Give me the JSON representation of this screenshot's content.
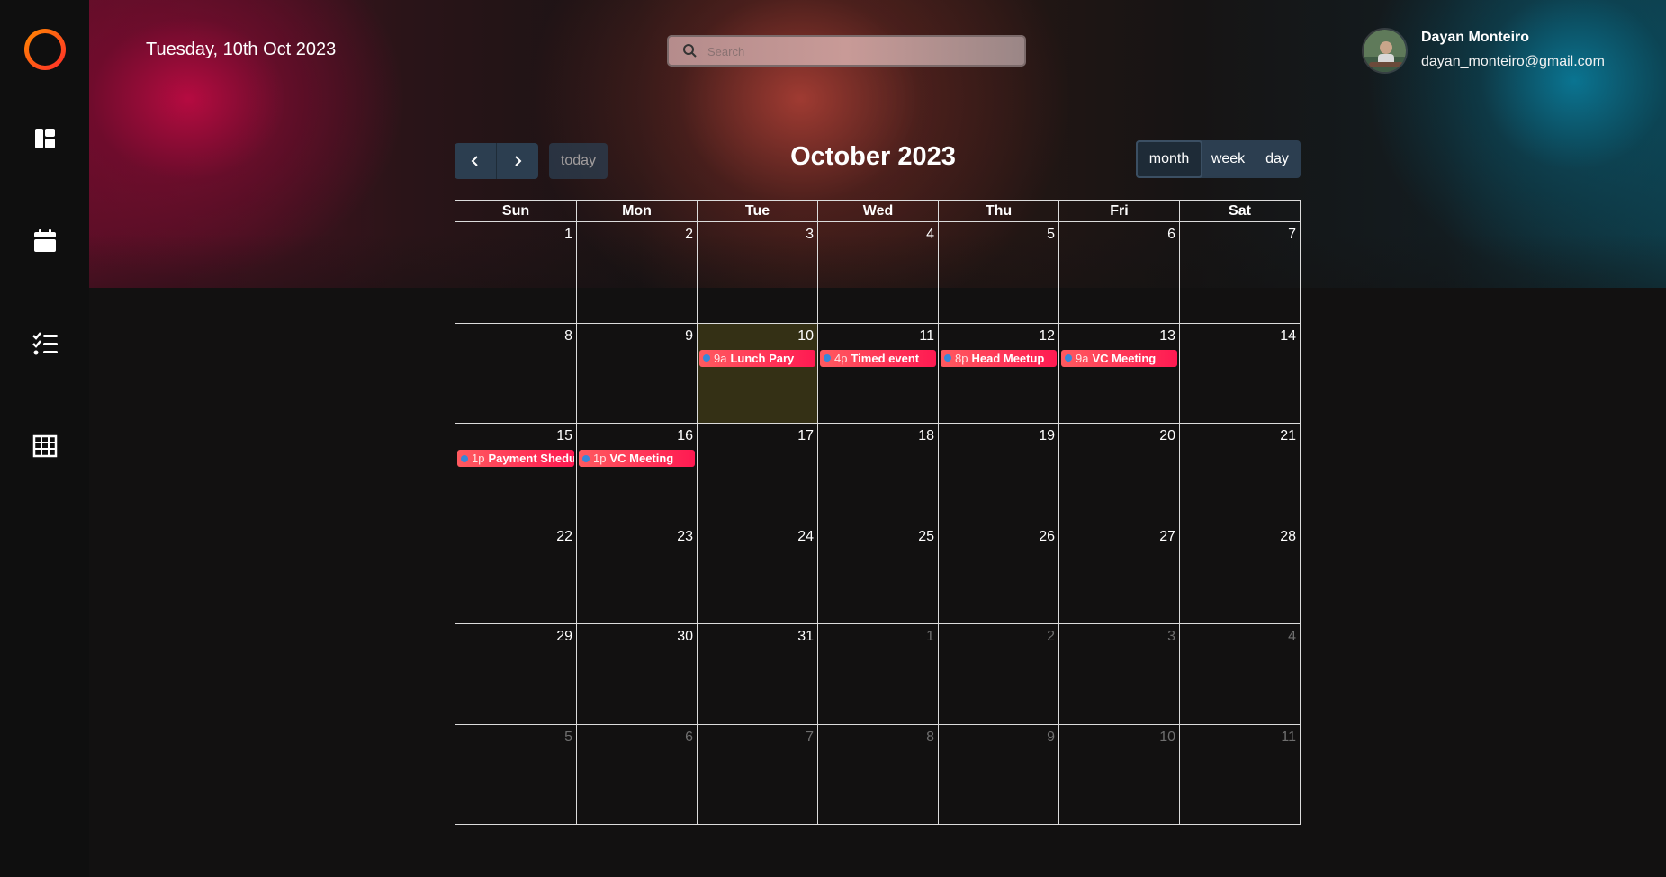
{
  "header": {
    "date": "Tuesday, 10th Oct 2023",
    "search_placeholder": "Search"
  },
  "user": {
    "name": "Dayan Monteiro",
    "email": "dayan_monteiro@gmail.com"
  },
  "sidebar": {
    "items": [
      {
        "icon": "dashboard-icon"
      },
      {
        "icon": "calendar-icon"
      },
      {
        "icon": "checklist-icon"
      },
      {
        "icon": "table-icon"
      }
    ]
  },
  "toolbar": {
    "today_label": "today",
    "title": "October 2023",
    "views": [
      "month",
      "week",
      "day"
    ],
    "active_view": "month"
  },
  "calendar": {
    "weekdays": [
      "Sun",
      "Mon",
      "Tue",
      "Wed",
      "Thu",
      "Fri",
      "Sat"
    ],
    "weeks": [
      [
        {
          "d": "1"
        },
        {
          "d": "2"
        },
        {
          "d": "3"
        },
        {
          "d": "4"
        },
        {
          "d": "5"
        },
        {
          "d": "6"
        },
        {
          "d": "7"
        }
      ],
      [
        {
          "d": "8"
        },
        {
          "d": "9"
        },
        {
          "d": "10",
          "today": true,
          "event": {
            "time": "9a",
            "title": "Lunch Pary"
          }
        },
        {
          "d": "11",
          "event": {
            "time": "4p",
            "title": "Timed event"
          }
        },
        {
          "d": "12",
          "event": {
            "time": "8p",
            "title": "Head Meetup"
          }
        },
        {
          "d": "13",
          "event": {
            "time": "9a",
            "title": "VC Meeting"
          }
        },
        {
          "d": "14"
        }
      ],
      [
        {
          "d": "15",
          "event": {
            "time": "1p",
            "title": "Payment Shedule"
          }
        },
        {
          "d": "16",
          "event": {
            "time": "1p",
            "title": "VC Meeting"
          }
        },
        {
          "d": "17"
        },
        {
          "d": "18"
        },
        {
          "d": "19"
        },
        {
          "d": "20"
        },
        {
          "d": "21"
        }
      ],
      [
        {
          "d": "22"
        },
        {
          "d": "23"
        },
        {
          "d": "24"
        },
        {
          "d": "25"
        },
        {
          "d": "26"
        },
        {
          "d": "27"
        },
        {
          "d": "28"
        }
      ],
      [
        {
          "d": "29"
        },
        {
          "d": "30"
        },
        {
          "d": "31"
        },
        {
          "d": "1",
          "other": true
        },
        {
          "d": "2",
          "other": true
        },
        {
          "d": "3",
          "other": true
        },
        {
          "d": "4",
          "other": true
        }
      ],
      [
        {
          "d": "5",
          "other": true
        },
        {
          "d": "6",
          "other": true
        },
        {
          "d": "7",
          "other": true
        },
        {
          "d": "8",
          "other": true
        },
        {
          "d": "9",
          "other": true
        },
        {
          "d": "10",
          "other": true
        },
        {
          "d": "11",
          "other": true
        }
      ]
    ]
  },
  "colors": {
    "background": "#121111",
    "sidebar": "#0f0f0f",
    "button": "#2c3e50",
    "event": "#ff1a52",
    "event_dot": "#3788d8",
    "today_highlight": "#7d731e"
  }
}
